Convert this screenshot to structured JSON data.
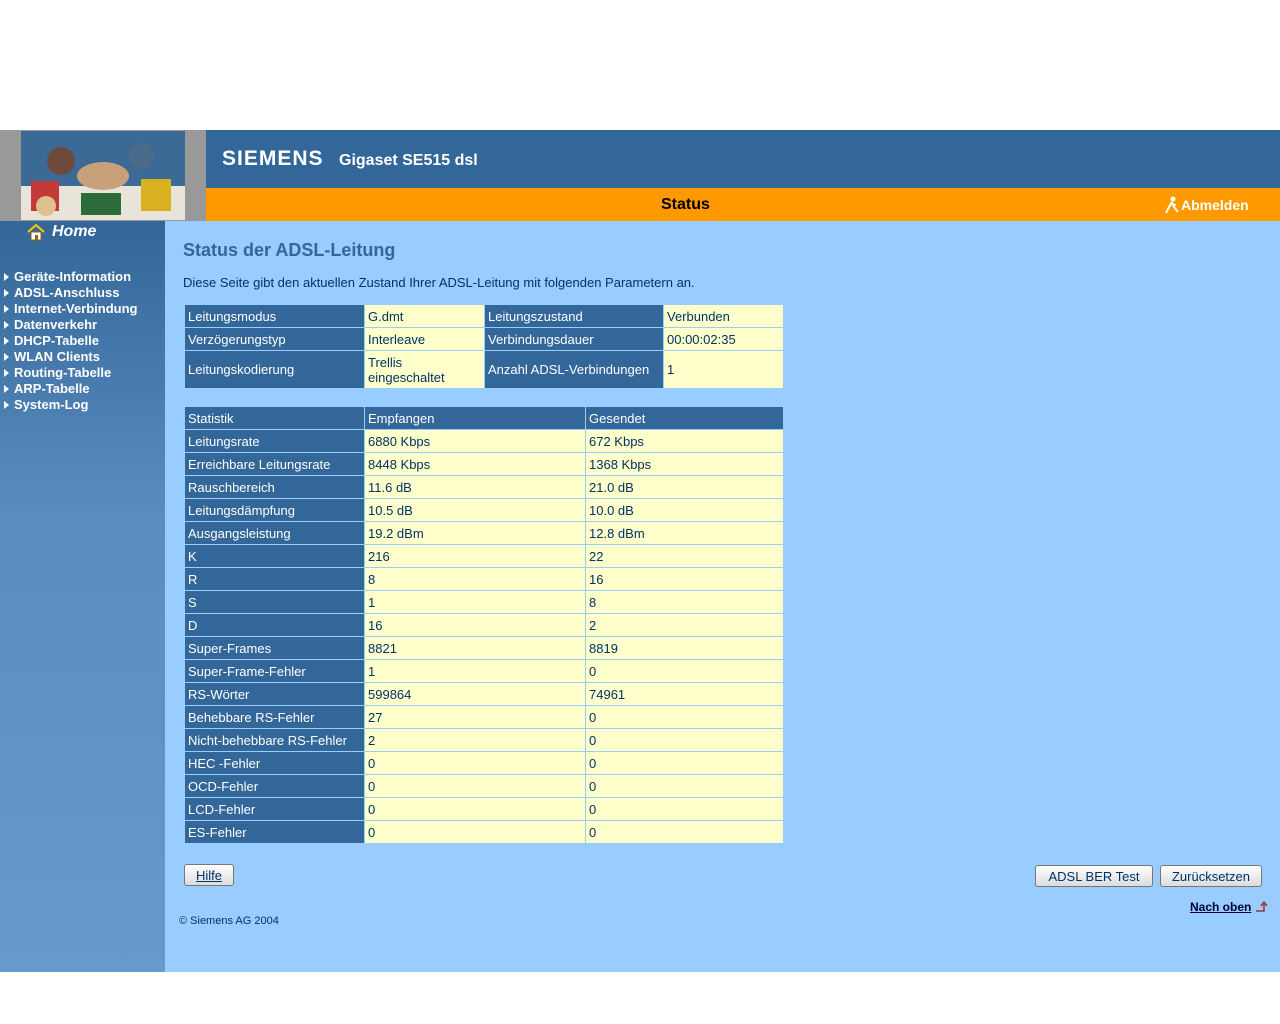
{
  "header": {
    "brand": "SIEMENS",
    "product": "Gigaset SE515 dsl",
    "page_name": "Status",
    "logout_label": "Abmelden"
  },
  "sidebar": {
    "home_label": "Home",
    "items": [
      {
        "label": "Geräte-Information"
      },
      {
        "label": "ADSL-Anschluss"
      },
      {
        "label": "Internet-Verbindung"
      },
      {
        "label": "Datenverkehr"
      },
      {
        "label": "DHCP-Tabelle"
      },
      {
        "label": "WLAN Clients"
      },
      {
        "label": "Routing-Tabelle"
      },
      {
        "label": "ARP-Tabelle"
      },
      {
        "label": "System-Log"
      }
    ]
  },
  "main": {
    "title": "Status der ADSL-Leitung",
    "description": "Diese Seite gibt den aktuellen Zustand Ihrer ADSL-Leitung mit folgenden Parametern an.",
    "line_info": [
      [
        "Leitungsmodus",
        "G.dmt",
        "Leitungszustand",
        "Verbunden"
      ],
      [
        "Verzögerungstyp",
        "Interleave",
        "Verbindungsdauer",
        "00:00:02:35"
      ],
      [
        "Leitungskodierung",
        "Trellis eingeschaltet",
        "Anzahl ADSL-Verbindungen",
        "1"
      ]
    ],
    "stats_headers": [
      "Statistik",
      "Empfangen",
      "Gesendet"
    ],
    "stats_rows": [
      [
        "Leitungsrate",
        "6880 Kbps",
        "672 Kbps"
      ],
      [
        "Erreichbare Leitungsrate",
        "8448 Kbps",
        "1368 Kbps"
      ],
      [
        "Rauschbereich",
        "11.6 dB",
        "21.0 dB"
      ],
      [
        "Leitungsdämpfung",
        "10.5 dB",
        "10.0 dB"
      ],
      [
        "Ausgangsleistung",
        "19.2 dBm",
        "12.8 dBm"
      ],
      [
        "K",
        "216",
        "22"
      ],
      [
        "R",
        "8",
        "16"
      ],
      [
        "S",
        "1",
        "8"
      ],
      [
        "D",
        "16",
        "2"
      ],
      [
        "Super-Frames",
        "8821",
        "8819"
      ],
      [
        "Super-Frame-Fehler",
        "1",
        "0"
      ],
      [
        "RS-Wörter",
        "599864",
        "74961"
      ],
      [
        "Behebbare RS-Fehler",
        "27",
        "0"
      ],
      [
        "Nicht-behebbare RS-Fehler",
        "2",
        "0"
      ],
      [
        "HEC -Fehler",
        "0",
        "0"
      ],
      [
        "OCD-Fehler",
        "0",
        "0"
      ],
      [
        "LCD-Fehler",
        "0",
        "0"
      ],
      [
        "ES-Fehler",
        "0",
        "0"
      ]
    ]
  },
  "buttons": {
    "help": "Hilfe",
    "ber_test": "ADSL BER Test",
    "reset": "Zurücksetzen"
  },
  "footer": {
    "top_link": "Nach oben",
    "copyright": "© Siemens AG 2004"
  }
}
